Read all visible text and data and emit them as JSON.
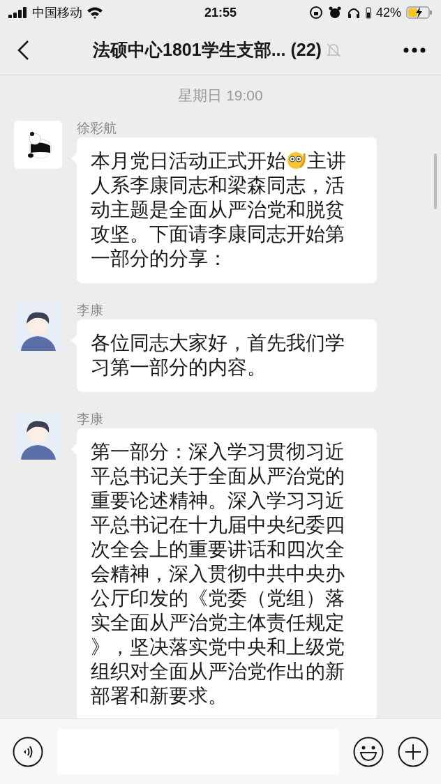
{
  "status_bar": {
    "carrier": "中国移动",
    "time": "21:55",
    "battery": "42%"
  },
  "header": {
    "title": "法硕中心1801学生支部... (22)",
    "muted": true
  },
  "timestamp": "星期日 19:00",
  "messages": [
    {
      "sender": "徐彩航",
      "avatar": {
        "kind": "panda"
      },
      "segments": [
        {
          "kind": "text",
          "text": "本月党日活动正式开始"
        },
        {
          "kind": "emoji"
        },
        {
          "kind": "text",
          "text": "主讲人系李康同志和梁森同志，活动主题是全面从严治党和脱贫攻坚。下面请李康同志开始第一部分的分享："
        }
      ]
    },
    {
      "sender": "李康",
      "avatar": {
        "kind": "person"
      },
      "segments": [
        {
          "kind": "text",
          "text": "各位同志大家好，首先我们学习第一部分的内容。"
        }
      ]
    },
    {
      "sender": "李康",
      "avatar": {
        "kind": "person"
      },
      "segments": [
        {
          "kind": "text",
          "text": "第一部分：深入学习贯彻习近平总书记关于全面从严治党的重要论述精神。深入学习习近平总书记在十九届中央纪委四次全会上的重要讲话和四次全会精神，深入贯彻中共中央办公厅印发的《党委（党组）落实全面从严治党主体责任规定》，坚决落实党中央和上级党组织对全面从严治党作出的新部署和新要求。"
        }
      ]
    }
  ]
}
